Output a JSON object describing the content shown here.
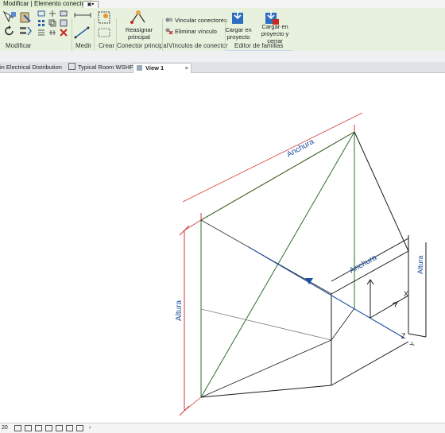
{
  "context_tab": {
    "label": "Modificar | Elemento conector",
    "qat_icon": "dropdown-arrow-icon"
  },
  "ribbon": {
    "modify": {
      "label": "Modificar"
    },
    "measure": {
      "label": "Medir"
    },
    "create": {
      "label": "Crear"
    },
    "reassign": {
      "label": "Reasignar principal"
    },
    "panel_primary": {
      "label": "Conector principal"
    },
    "link_connectors": {
      "label": "Vincular conectores"
    },
    "remove_link": {
      "label": "Eliminar vínculo"
    },
    "panel_links": {
      "label": "Vínculos de conector"
    },
    "load_project": {
      "label": "Cargar en proyecto"
    },
    "load_close": {
      "label": "Cargar en proyecto y cerrar"
    },
    "panel_editor": {
      "label": "Editor de familias"
    }
  },
  "doc_tabs": [
    {
      "label": "in Electrical Distribution"
    },
    {
      "label": "Typical Room WSHP"
    },
    {
      "label": "View 1",
      "close": "×"
    }
  ],
  "drawing": {
    "width_label_top": "Anchura",
    "height_label_left": "Altura",
    "width_label_connector": "Anchura",
    "height_label_connector": "Altura",
    "axis_x": "X",
    "axis_y": "Y",
    "axis_z": "Z",
    "colors": {
      "frame": "#2c6e2c",
      "dimension": "#d23a3a",
      "connector": "#1e4fa0",
      "edges": "#1a1a1a"
    }
  },
  "status": {
    "scale": "20"
  }
}
